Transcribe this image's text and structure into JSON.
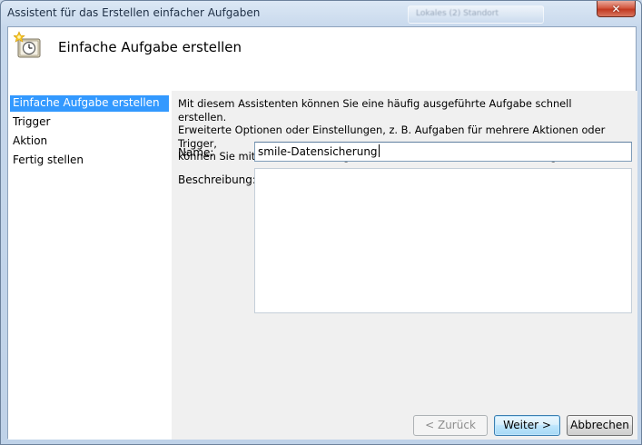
{
  "window": {
    "title": "Assistent für das Erstellen einfacher Aufgaben",
    "background_tab_text": "Lokales (2) Standort",
    "close_symbol": "✕"
  },
  "header": {
    "title": "Einfache Aufgabe erstellen",
    "icon": "task-scheduler-clock-icon"
  },
  "nav": {
    "items": [
      {
        "label": "Einfache Aufgabe erstellen",
        "active": true
      },
      {
        "label": "Trigger",
        "active": false
      },
      {
        "label": "Aktion",
        "active": false
      },
      {
        "label": "Fertig stellen",
        "active": false
      }
    ]
  },
  "content": {
    "description": [
      "Mit diesem Assistenten können Sie eine häufig ausgeführte Aufgabe schnell erstellen.",
      "Erweiterte Optionen oder Einstellungen, z. B. Aufgaben für mehrere Aktionen oder Trigger,",
      "können Sie mit dem Befehl \"Aufgabe erstellen\" im Aktionsbereich festlegen."
    ],
    "name_label": "Name:",
    "name_value": "smile-Datensicherung",
    "description_label": "Beschreibung:",
    "description_value": ""
  },
  "buttons": {
    "back": "< Zurück",
    "next": "Weiter >",
    "cancel": "Abbrechen"
  },
  "colors": {
    "selection": "#3399ff",
    "content_background": "#f0f0f0",
    "close_button": "#c23a22"
  }
}
